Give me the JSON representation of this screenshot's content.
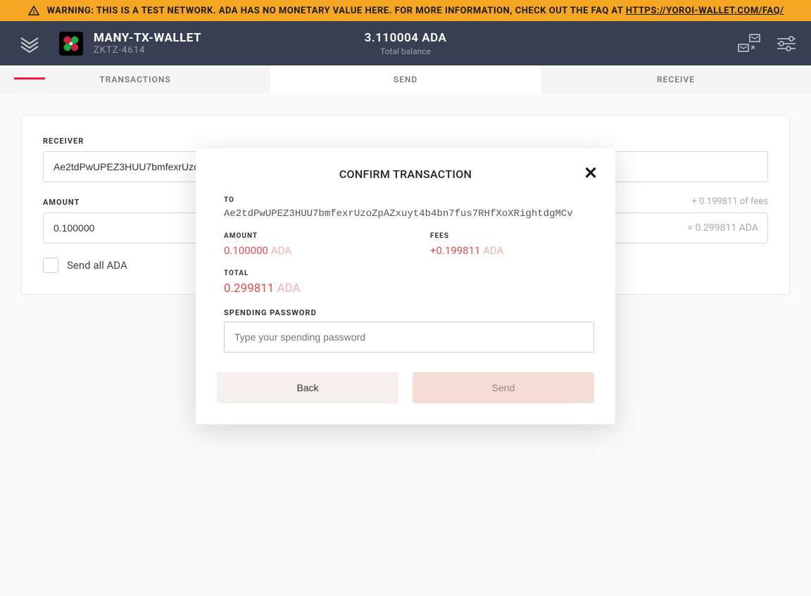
{
  "warning": {
    "text_prefix": "WARNING: THIS IS A TEST NETWORK. ADA HAS NO MONETARY VALUE HERE. FOR MORE INFORMATION, CHECK OUT THE FAQ AT ",
    "link_text": "HTTPS://YOROI-WALLET.COM/FAQ/"
  },
  "header": {
    "wallet_name": "MANY-TX-WALLET",
    "wallet_code": "ZKTZ-4614",
    "balance": "3.110004 ADA",
    "balance_label": "Total balance"
  },
  "tabs": {
    "transactions": "TRANSACTIONS",
    "send": "SEND",
    "receive": "RECEIVE"
  },
  "send_form": {
    "receiver_label": "RECEIVER",
    "receiver_value": "Ae2tdPwUPEZ3HUU7bmfexrUzo",
    "amount_label": "AMOUNT",
    "amount_value": "0.100000",
    "fee_hint": "+ 0.199811 of fees",
    "total_hint": "= 0.299811 ADA",
    "send_all_label": "Send all ADA"
  },
  "modal": {
    "title": "CONFIRM TRANSACTION",
    "to_label": "TO",
    "to_value": "Ae2tdPwUPEZ3HUU7bmfexrUzoZpAZxuyt4b4bn7fus7RHfXoXRightdgMCv",
    "amount_label": "AMOUNT",
    "amount_value": "0.100000",
    "amount_currency": "ADA",
    "fees_label": "FEES",
    "fees_value": "+0.199811",
    "fees_currency": "ADA",
    "total_label": "TOTAL",
    "total_value": "0.299811",
    "total_currency": "ADA",
    "password_label": "SPENDING PASSWORD",
    "password_placeholder": "Type your spending password",
    "back_label": "Back",
    "send_label": "Send"
  }
}
